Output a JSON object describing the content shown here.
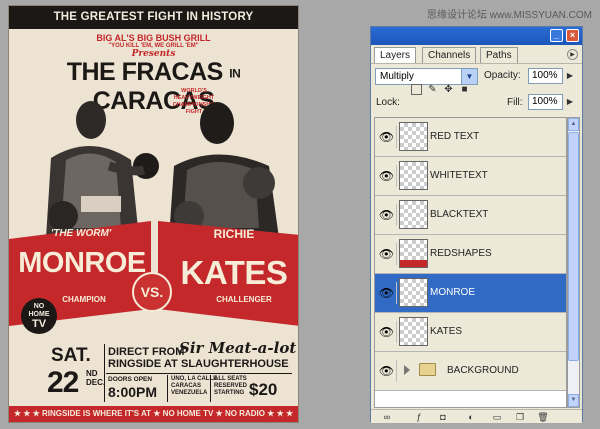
{
  "watermark": "思缘设计论坛 www.MISSYUAN.COM",
  "poster": {
    "topbar": "THE GREATEST FIGHT IN HISTORY",
    "sponsor": "BIG AL'S BIG BUSH GRILL",
    "tagline": "\"YOU KILL 'EM, WE GRILL 'EM\"",
    "presents": "Presents",
    "title_left": "THE FRACAS",
    "title_in": "IN",
    "title_right": "CARACAS",
    "subtitle_1": "WORLD'S",
    "subtitle_2": "HEAVYWEIGHT",
    "subtitle_3": "CHAMPIONSHIP",
    "subtitle_4": "FIGHT",
    "left_nickname": "'THE WORM'",
    "left_name": "MONROE",
    "left_status": "CHAMPION",
    "vs": "VS.",
    "right_first": "RICHIE",
    "right_name": "KATES",
    "right_status": "CHALLENGER",
    "tv_1": "NO",
    "tv_2": "HOME",
    "tv_3": "TV",
    "day_name": "SAT.",
    "day_num": "22",
    "day_suffix_1": "ND",
    "day_suffix_2": "DEC.",
    "direct_1": "DIRECT FROM",
    "direct_2": "RINGSIDE AT",
    "venue_sir": "Sir Meat-a-lot",
    "venue": "SLAUGHTERHOUSE",
    "doors": "DOORS OPEN",
    "time": "8:00PM",
    "address_1": "UNO, LA CALLE",
    "address_2": "CARACAS",
    "address_3": "VENEZUELA",
    "seats_1": "ALL SEATS",
    "seats_2": "RESERVED",
    "seats_3": "STARTING",
    "price": "$20",
    "bottom": "★ ★ ★ RINGSIDE IS WHERE IT'S AT ★ NO HOME TV ★ NO RADIO ★ ★ ★"
  },
  "panel": {
    "tabs": [
      "Layers",
      "Channels",
      "Paths"
    ],
    "blend_mode": "Multiply",
    "opacity_label": "Opacity:",
    "opacity_value": "100%",
    "lock_label": "Lock:",
    "fill_label": "Fill:",
    "fill_value": "100%",
    "layers": [
      {
        "name": "RED TEXT",
        "selected": false
      },
      {
        "name": "WHITETEXT",
        "selected": false
      },
      {
        "name": "BLACKTEXT",
        "selected": false
      },
      {
        "name": "REDSHAPES",
        "selected": false
      },
      {
        "name": "MONROE",
        "selected": true
      },
      {
        "name": "KATES",
        "selected": false
      }
    ],
    "group": {
      "name": "BACKGROUND"
    },
    "colors": {
      "selection": "#316ac5",
      "poster_red": "#c4282a",
      "poster_paper": "#ece3d3"
    }
  }
}
